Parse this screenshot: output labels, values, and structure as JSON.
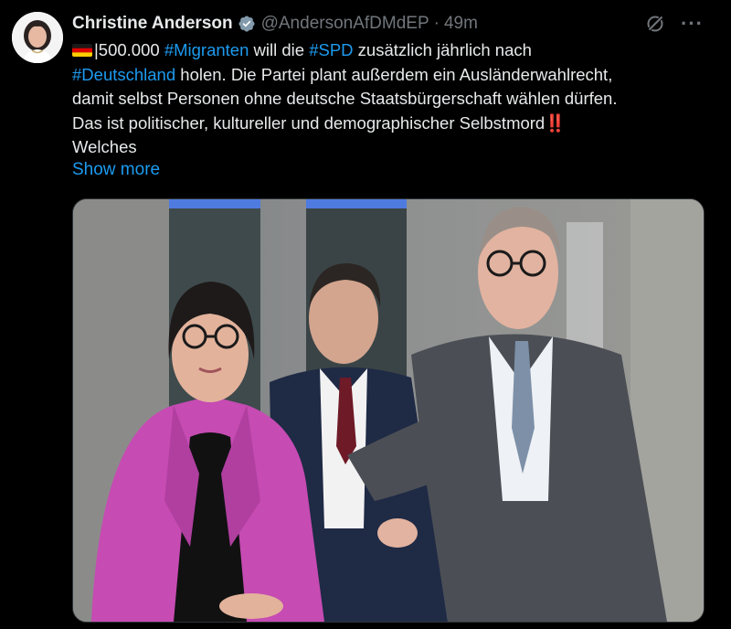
{
  "author": {
    "name": "Christine Anderson",
    "handle": "@AndersonAfDMdEP",
    "separator": "·",
    "time": "49m",
    "verified": true
  },
  "icons": {
    "avatar": "profile-photo",
    "verified": "verified-badge-icon",
    "grok": "grok-icon",
    "more": "more-options-icon",
    "flag": "german-flag-emoji",
    "bang": "double-exclamation-emoji"
  },
  "tweet": {
    "line1_pre": "|500.000 ",
    "line1_tag1": "#Migranten",
    "line1_mid": " will die ",
    "line1_tag2": "#SPD",
    "line1_post": " zusätzlich jährlich nach",
    "line2_tag": "#Deutschland",
    "line2_post": " holen. Die Partei plant außerdem ein Ausländerwahlrecht,",
    "line3": "damit selbst Personen ohne deutsche Staatsbürgerschaft wählen dürfen.",
    "line4": "Das ist politischer, kultureller und demographischer Selbstmord",
    "line4_emoji": "‼️",
    "line5": "Welches",
    "show_more": "Show more"
  },
  "colors": {
    "background": "#000000",
    "text": "#e7e9ea",
    "secondary": "#71767b",
    "link": "#1d9bf0",
    "verified": "#829aab"
  }
}
